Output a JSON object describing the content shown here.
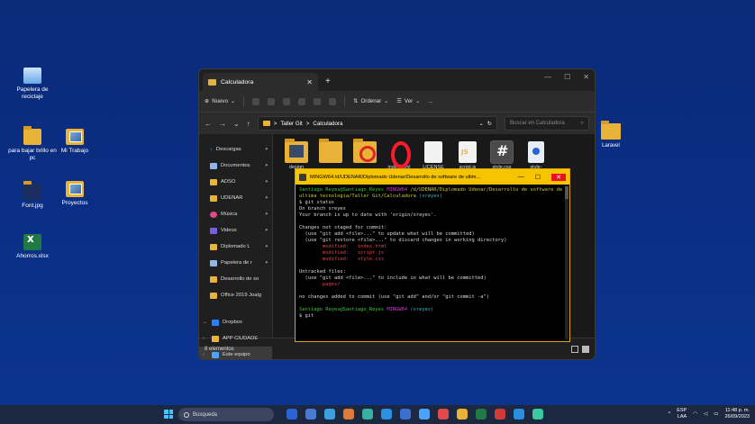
{
  "desktop": {
    "icons": [
      {
        "label": "Papelera de reciclaje",
        "icon": "recycle-bin-icon"
      },
      {
        "label": "para bajar brillo en pc",
        "icon": "folder-icon"
      },
      {
        "label": "Mi Trabajo",
        "icon": "photo-folder-icon"
      },
      {
        "label": "Font.jpg",
        "icon": "image-file-icon"
      },
      {
        "label": "Proyectos",
        "icon": "photo-folder-icon"
      },
      {
        "label": "Ahorros.xlsx",
        "icon": "excel-file-icon"
      },
      {
        "label": "Laravel",
        "icon": "folder-icon"
      }
    ]
  },
  "explorer": {
    "tab_title": "Calculadora",
    "toolbar": {
      "new_label": "Nuevo",
      "sort_label": "Ordenar",
      "view_label": "Ver",
      "more_label": "..."
    },
    "breadcrumb": [
      "Taller Git",
      "Calculadora"
    ],
    "breadcrumb_sep": ">",
    "search_placeholder": "Buscar en Calculadora",
    "nav_items": [
      {
        "label": "Descargas",
        "icon": "download-icon",
        "color": "#4aa3ff"
      },
      {
        "label": "Documentos",
        "icon": "documents-icon",
        "color": "#8fb6e6"
      },
      {
        "label": "ADSO",
        "icon": "folder-icon",
        "color": "#e9b33a"
      },
      {
        "label": "UDENAR",
        "icon": "folder-icon",
        "color": "#e9b33a"
      },
      {
        "label": "Música",
        "icon": "music-icon",
        "color": "#e04a8a"
      },
      {
        "label": "Videos",
        "icon": "video-icon",
        "color": "#7a5ae0"
      },
      {
        "label": "Diplomado L",
        "icon": "folder-icon",
        "color": "#e9b33a"
      },
      {
        "label": "Papelera de r",
        "icon": "recycle-bin-icon",
        "color": "#8fb6e6"
      },
      {
        "label": "Desarrollo de so",
        "icon": "folder-icon",
        "color": "#e9b33a"
      },
      {
        "label": "Office 2019 Joalg",
        "icon": "folder-icon",
        "color": "#e9b33a"
      }
    ],
    "nav_bottom": [
      {
        "label": "Dropbox",
        "icon": "dropbox-icon",
        "color": "#2a7fff"
      },
      {
        "label": "APP CIUDADE",
        "icon": "folder-icon",
        "color": "#e9b33a"
      },
      {
        "label": "Este equipo",
        "icon": "computer-icon",
        "color": "#4aa3ff"
      }
    ],
    "files": [
      {
        "label": "design",
        "kind": "folder-img"
      },
      {
        "label": "",
        "kind": "folder"
      },
      {
        "label": "",
        "kind": "folder-red"
      },
      {
        "label": "index.html",
        "kind": "opera"
      },
      {
        "label": "LICENSE",
        "kind": "doc"
      },
      {
        "label": "script.js",
        "kind": "js"
      },
      {
        "label": "style.css",
        "kind": "hash"
      },
      {
        "label": "style-guide.md",
        "kind": "down"
      }
    ],
    "status_text": "8 elementos"
  },
  "bash": {
    "title": "MINGW64:/d/UDENAR/Diplomado Udenar/Desarrollo de software de ultim...",
    "user": "Santiago Reyes@Santiago_Reyes",
    "env": "MINGW64",
    "path": "/d/UDENAR/Diplomado Udenar/Desarrollo de software de ultima tecnologia/Taller Git/Calculadora",
    "branch": "(sreyes)",
    "cmd1": "$ git status",
    "line_on_branch": "On branch sreyes",
    "line_uptodate": "Your branch is up to date with 'origin/sreyes'.",
    "line_not_staged": "Changes not staged for commit:",
    "hint_add": "(use \"git add <file>...\" to update what will be committed)",
    "hint_restore": "(use \"git restore <file>...\" to discard changes in working directory)",
    "modified": [
      {
        "label": "modified:",
        "file": "index.html"
      },
      {
        "label": "modified:",
        "file": "script.js"
      },
      {
        "label": "modified:",
        "file": "style.css"
      }
    ],
    "line_untracked": "Untracked files:",
    "hint_untracked": "(use \"git add <file>...\" to include in what will be committed)",
    "untracked_file": "pages/",
    "line_no_changes": "no changes added to commit (use \"git add\" and/or \"git commit -a\")",
    "cmd2": "$ git"
  },
  "taskbar": {
    "search_label": "Búsqueda",
    "lang": "ESP",
    "lang_sub": "LAA",
    "time": "11:48 p. m.",
    "date": "26/09/2023",
    "app_colors": [
      "#2a63d6",
      "#4a7ad8",
      "#3aa0e0",
      "#e07a3a",
      "#3ab0a0",
      "#2a90e0",
      "#3a70d0",
      "#4aa3ff",
      "#e04a4a",
      "#e9b33a",
      "#1f7a45",
      "#d23a3a",
      "#2a8fe0",
      "#3ac8a0"
    ]
  }
}
